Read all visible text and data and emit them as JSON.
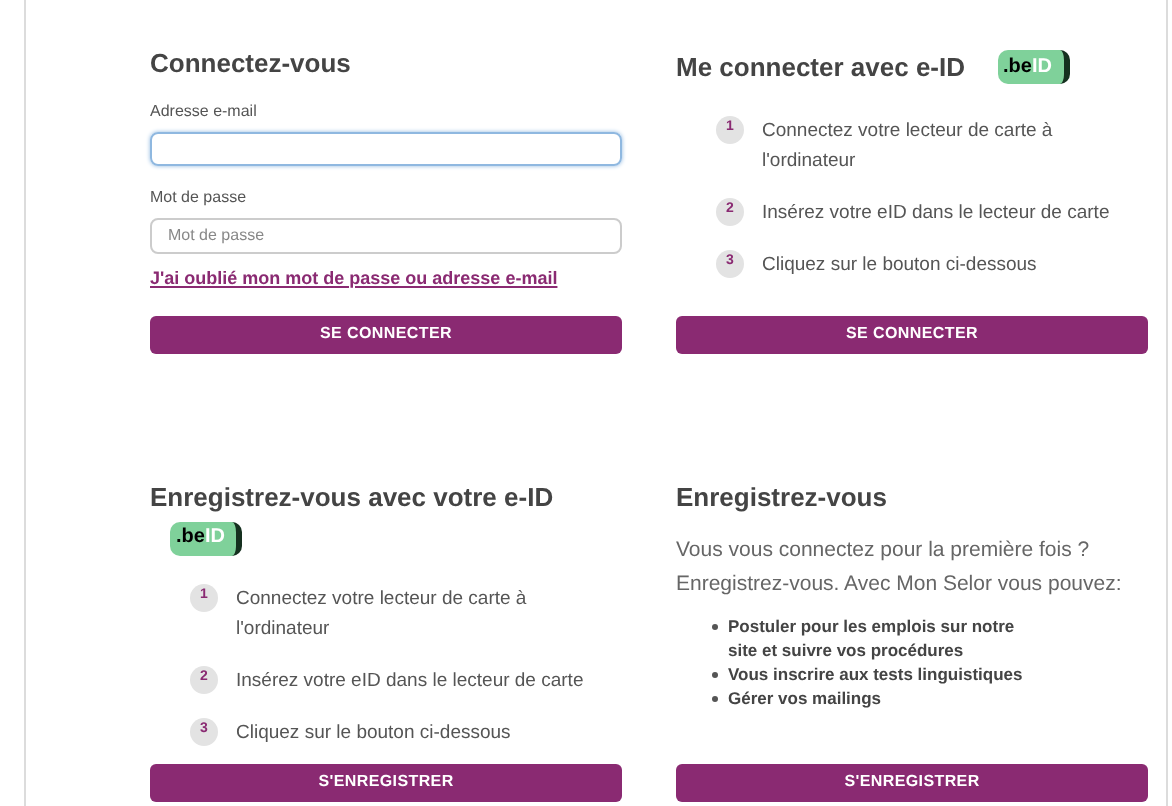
{
  "login": {
    "title": "Connectez-vous",
    "email_label": "Adresse e-mail",
    "password_label": "Mot de passe",
    "password_placeholder": "Mot de passe",
    "forgot_link": "J'ai oublié mon mot de passe ou adresse e-mail",
    "button": "SE CONNECTER"
  },
  "eid_login": {
    "title": "Me connecter avec e-ID",
    "logo": {
      "prefix": ".be",
      "suffix": "ID"
    },
    "steps": [
      {
        "number": "1",
        "text": "Connectez votre lecteur de carte à l'ordinateur"
      },
      {
        "number": "2",
        "text": "Insérez votre eID dans le lecteur de carte"
      },
      {
        "number": "3",
        "text": "Cliquez sur le bouton ci-dessous"
      }
    ],
    "button": "SE CONNECTER"
  },
  "eid_register": {
    "title": "Enregistrez-vous avec votre e-ID",
    "logo": {
      "prefix": ".be",
      "suffix": "ID"
    },
    "steps": [
      {
        "number": "1",
        "text": "Connectez votre lecteur de carte à l'ordinateur"
      },
      {
        "number": "2",
        "text": "Insérez votre eID dans le lecteur de carte"
      },
      {
        "number": "3",
        "text": "Cliquez sur le bouton ci-dessous"
      }
    ],
    "button": "S'ENREGISTRER"
  },
  "register": {
    "title": "Enregistrez-vous",
    "intro": "Vous vous connectez pour la première fois ? Enregistrez-vous. Avec Mon Selor vous pouvez:",
    "benefits": [
      "Postuler pour les emplois sur notre site et suivre vos procédures",
      "Vous inscrire aux tests linguistiques",
      "Gérer vos mailings"
    ],
    "button": "S'ENREGISTRER"
  }
}
